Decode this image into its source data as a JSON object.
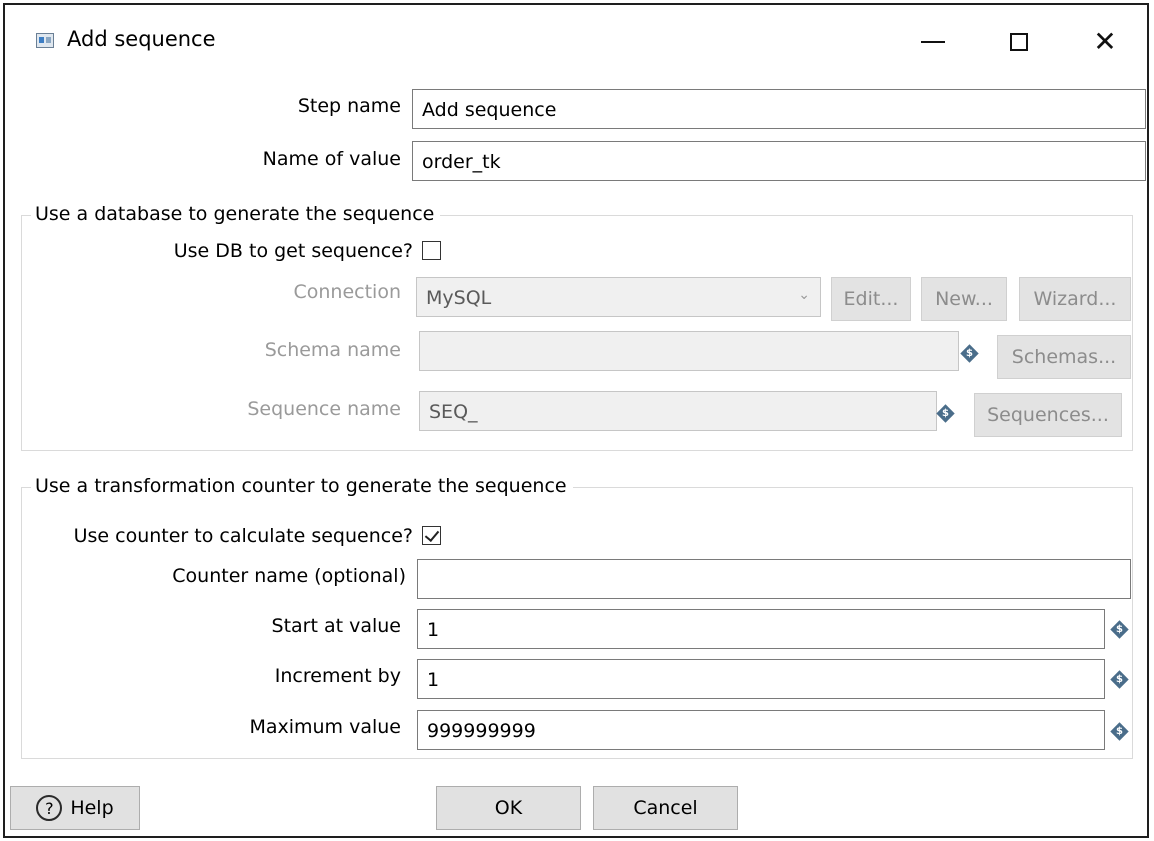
{
  "window": {
    "title": "Add sequence",
    "controls": {
      "minimize": "—",
      "maximize": "",
      "close": "✕"
    }
  },
  "step_name": {
    "label": "Step name",
    "value": "Add sequence"
  },
  "name_of_value": {
    "label": "Name of value",
    "value": "order_tk"
  },
  "db_group": {
    "title": "Use a database to generate the sequence",
    "use_db_label": "Use DB to get sequence?",
    "use_db_checked": false,
    "connection": {
      "label": "Connection",
      "value": "MySQL",
      "arrow": "⌄"
    },
    "edit_button": "Edit...",
    "new_button": "New...",
    "wizard_button": "Wizard...",
    "schema": {
      "label": "Schema name",
      "value": ""
    },
    "schemas_button": "Schemas...",
    "sequence": {
      "label": "Sequence name",
      "value": "SEQ_"
    },
    "sequences_button": "Sequences..."
  },
  "counter_group": {
    "title": "Use a transformation counter to generate the sequence",
    "use_counter_label": "Use counter to calculate sequence?",
    "use_counter_checked": true,
    "counter_name": {
      "label": "Counter name (optional)",
      "value": ""
    },
    "start_value": {
      "label": "Start at value",
      "value": "1"
    },
    "increment": {
      "label": "Increment by",
      "value": "1"
    },
    "maximum": {
      "label": "Maximum value",
      "value": "999999999"
    }
  },
  "footer": {
    "help_button": "Help",
    "help_icon": "?",
    "ok_button": "OK",
    "cancel_button": "Cancel"
  },
  "variable_icon_glyph": "$"
}
